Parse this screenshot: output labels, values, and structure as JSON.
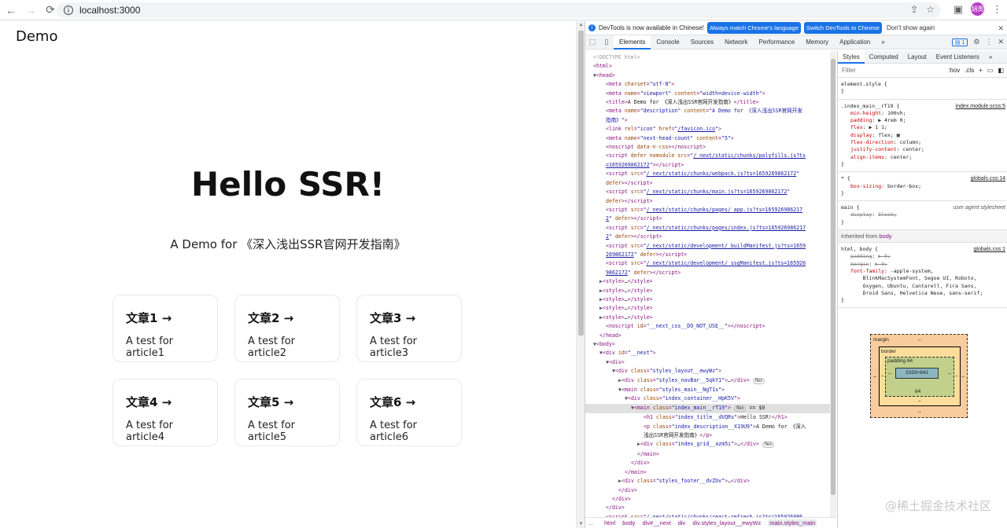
{
  "browser": {
    "url": "localhost:3000",
    "avatar": "胡周"
  },
  "page": {
    "brand": "Demo",
    "title": "Hello SSR!",
    "description": "A Demo for 《深入浅出SSR官网开发指南》",
    "cards": [
      {
        "title": "文章1 →",
        "text": "A test for article1"
      },
      {
        "title": "文章2 →",
        "text": "A test for article2"
      },
      {
        "title": "文章3 →",
        "text": "A test for article3"
      },
      {
        "title": "文章4 →",
        "text": "A test for article4"
      },
      {
        "title": "文章5 →",
        "text": "A test for article5"
      },
      {
        "title": "文章6 →",
        "text": "A test for article6"
      }
    ]
  },
  "devtools": {
    "infobar": {
      "message": "DevTools is now available in Chinese!",
      "match_btn": "Always match Chrome's language",
      "switch_btn": "Switch DevTools to Chinese",
      "dismiss": "Don't show again"
    },
    "tabs": [
      "Elements",
      "Console",
      "Sources",
      "Network",
      "Performance",
      "Memory",
      "Application"
    ],
    "issues_badge": "1",
    "styles_tabs": [
      "Styles",
      "Computed",
      "Layout",
      "Event Listeners"
    ],
    "filter_placeholder": "Filter",
    "hov": ":hov",
    "cls": ".cls",
    "breadcrumbs": [
      "html",
      "body",
      "div#__next",
      "div",
      "div.styles_layout__ewyWz",
      "main.styles_main"
    ],
    "inherited_label": "Inherited from",
    "inherited_from": "body",
    "box_model": {
      "margin": "margin",
      "border": "border",
      "padding": "padding 64",
      "content": "1033×841",
      "padding_bottom": "64",
      "dash": "–"
    },
    "rules": [
      {
        "selector": "element.style {",
        "source": "",
        "props": [],
        "close": "}"
      },
      {
        "selector": ".index_main__rT19 {",
        "source": "index.module.scss:5",
        "props": [
          {
            "n": "min-height",
            "v": "100vh;"
          },
          {
            "n": "padding",
            "v": "▶ 4rem 0;"
          },
          {
            "n": "flex",
            "v": "▶ 1 1;"
          },
          {
            "n": "display",
            "v": "flex; ▦"
          },
          {
            "n": "flex-direction",
            "v": "column;"
          },
          {
            "n": "justify-content",
            "v": "center;"
          },
          {
            "n": "align-items",
            "v": "center;"
          }
        ],
        "close": "}"
      },
      {
        "selector": "* {",
        "source": "globals.css:14",
        "props": [
          {
            "n": "box-sizing",
            "v": "border-box;"
          }
        ],
        "close": "}"
      },
      {
        "selector": "main {",
        "source": "user agent stylesheet",
        "ua": true,
        "props": [
          {
            "n": "display",
            "v": "block;",
            "struck": true
          }
        ],
        "close": "}"
      }
    ],
    "body_rule": {
      "selector": "html, body {",
      "source": "globals.css:1",
      "props": [
        {
          "n": "padding",
          "v": "▶ 0;",
          "struck": true
        },
        {
          "n": "margin",
          "v": "▶ 0;",
          "struck": true
        },
        {
          "n": "font-family",
          "v": "-apple-system,"
        },
        {
          "n": "",
          "v": "    BlinkMacSystemFont, Segoe UI, Roboto,"
        },
        {
          "n": "",
          "v": "    Oxygen, Ubuntu, Cantarell, Fira Sans,"
        },
        {
          "n": "",
          "v": "    Droid Sans, Helvetica Neue, sans-serif;"
        }
      ],
      "close": "}"
    },
    "dom_lines": [
      {
        "i": 0,
        "html": "<span class='cmt'>&lt;!DOCTYPE html&gt;</span>"
      },
      {
        "i": 0,
        "html": "<span class='tag'>&lt;html&gt;</span>"
      },
      {
        "i": 0,
        "html": "<span class='tri'>▼</span><span class='tag'>&lt;head&gt;</span>"
      },
      {
        "i": 2,
        "html": "<span class='tag'>&lt;meta </span><span class='attr'>charset</span>=<span class='val'>\"utf-8\"</span><span class='tag'>&gt;</span>"
      },
      {
        "i": 2,
        "html": "<span class='tag'>&lt;meta </span><span class='attr'>name</span>=<span class='val'>\"viewport\"</span> <span class='attr'>content</span>=<span class='val'>\"width=device-width\"</span><span class='tag'>&gt;</span>"
      },
      {
        "i": 2,
        "html": "<span class='tag'>&lt;title&gt;</span><span class='txt'>A Demo for 《深入浅出SSR官网开发指南》</span><span class='tag'>&lt;/title&gt;</span>"
      },
      {
        "i": 2,
        "html": "<span class='tag'>&lt;meta </span><span class='attr'>name</span>=<span class='val'>\"description\"</span> <span class='attr'>content</span>=<span class='val'>\"A Demo for 《深入浅出SSR官网开发</span>"
      },
      {
        "i": 2,
        "html": "<span class='val'>指南》\"</span><span class='tag'>&gt;</span>"
      },
      {
        "i": 2,
        "html": "<span class='tag'>&lt;link </span><span class='attr'>rel</span>=<span class='val'>\"icon\"</span> <span class='attr'>href</span>=<span class='val'>\"<span class='link'>/favicon.ico</span>\"</span><span class='tag'>&gt;</span>"
      },
      {
        "i": 2,
        "html": "<span class='tag'>&lt;meta </span><span class='attr'>name</span>=<span class='val'>\"next-head-count\"</span> <span class='attr'>content</span>=<span class='val'>\"5\"</span><span class='tag'>&gt;</span>"
      },
      {
        "i": 2,
        "html": "<span class='tag'>&lt;noscript </span><span class='attr'>data-n-css</span><span class='tag'>&gt;&lt;/noscript&gt;</span>"
      },
      {
        "i": 2,
        "html": "<span class='tag'>&lt;script </span><span class='attr'>defer nomodule src</span>=<span class='val'>\"<span class='link'>/_next/static/chunks/polyfills.js?ts</span></span>"
      },
      {
        "i": 2,
        "html": "<span class='link val'>=1659269862172</span><span class='val'>\"</span><span class='tag'>&gt;&lt;/script&gt;</span>"
      },
      {
        "i": 2,
        "html": "<span class='tag'>&lt;script </span><span class='attr'>src</span>=<span class='val'>\"<span class='link'>/_next/static/chunks/webpack.js?ts=1659269862172</span>\"</span>"
      },
      {
        "i": 2,
        "html": "<span class='attr'>defer</span><span class='tag'>&gt;&lt;/script&gt;</span>"
      },
      {
        "i": 2,
        "html": "<span class='tag'>&lt;script </span><span class='attr'>src</span>=<span class='val'>\"<span class='link'>/_next/static/chunks/main.js?ts=1659269862172</span>\"</span>"
      },
      {
        "i": 2,
        "html": "<span class='attr'>defer</span><span class='tag'>&gt;&lt;/script&gt;</span>"
      },
      {
        "i": 2,
        "html": "<span class='tag'>&lt;script </span><span class='attr'>src</span>=<span class='val'>\"<span class='link'>/_next/static/chunks/pages/_app.js?ts=165926986217</span></span>"
      },
      {
        "i": 2,
        "html": "<span class='link val'>2</span><span class='val'>\"</span> <span class='attr'>defer</span><span class='tag'>&gt;&lt;/script&gt;</span>"
      },
      {
        "i": 2,
        "html": "<span class='tag'>&lt;script </span><span class='attr'>src</span>=<span class='val'>\"<span class='link'>/_next/static/chunks/pages/index.js?ts=165926986217</span></span>"
      },
      {
        "i": 2,
        "html": "<span class='link val'>2</span><span class='val'>\"</span> <span class='attr'>defer</span><span class='tag'>&gt;&lt;/script&gt;</span>"
      },
      {
        "i": 2,
        "html": "<span class='tag'>&lt;script </span><span class='attr'>src</span>=<span class='val'>\"<span class='link'>/_next/static/development/_buildManifest.js?ts=1659</span></span>"
      },
      {
        "i": 2,
        "html": "<span class='link val'>269862172</span><span class='val'>\"</span> <span class='attr'>defer</span><span class='tag'>&gt;&lt;/script&gt;</span>"
      },
      {
        "i": 2,
        "html": "<span class='tag'>&lt;script </span><span class='attr'>src</span>=<span class='val'>\"<span class='link'>/_next/static/development/_ssgManifest.js?ts=165926</span></span>"
      },
      {
        "i": 2,
        "html": "<span class='link val'>9862172</span><span class='val'>\"</span> <span class='attr'>defer</span><span class='tag'>&gt;&lt;/script&gt;</span>"
      },
      {
        "i": 1,
        "html": "<span class='tri'>▶</span><span class='tag'>&lt;style&gt;</span><span class='txt'>…</span><span class='tag'>&lt;/style&gt;</span>"
      },
      {
        "i": 1,
        "html": "<span class='tri'>▶</span><span class='tag'>&lt;style&gt;</span><span class='txt'>…</span><span class='tag'>&lt;/style&gt;</span>"
      },
      {
        "i": 1,
        "html": "<span class='tri'>▶</span><span class='tag'>&lt;style&gt;</span><span class='txt'>…</span><span class='tag'>&lt;/style&gt;</span>"
      },
      {
        "i": 1,
        "html": "<span class='tri'>▶</span><span class='tag'>&lt;style&gt;</span><span class='txt'>…</span><span class='tag'>&lt;/style&gt;</span>"
      },
      {
        "i": 1,
        "html": "<span class='tri'>▶</span><span class='tag'>&lt;style&gt;</span><span class='txt'>…</span><span class='tag'>&lt;/style&gt;</span>"
      },
      {
        "i": 2,
        "html": "<span class='tag'>&lt;noscript </span><span class='attr'>id</span>=<span class='val'>\"__next_css__DO_NOT_USE__\"</span><span class='tag'>&gt;&lt;/noscript&gt;</span>"
      },
      {
        "i": 1,
        "html": "<span class='tag'>&lt;/head&gt;</span>"
      },
      {
        "i": 0,
        "html": "<span class='tri'>▼</span><span class='tag'>&lt;body&gt;</span>"
      },
      {
        "i": 1,
        "html": "<span class='tri'>▼</span><span class='tag'>&lt;div </span><span class='attr'>id</span>=<span class='val'>\"__next\"</span><span class='tag'>&gt;</span>"
      },
      {
        "i": 2,
        "html": "<span class='tri'>▼</span><span class='tag'>&lt;div&gt;</span>"
      },
      {
        "i": 3,
        "html": "<span class='tri'>▼</span><span class='tag'>&lt;div </span><span class='attr'>class</span>=<span class='val'>\"styles_layout__ewyWz\"</span><span class='tag'>&gt;</span>"
      },
      {
        "i": 4,
        "html": "<span class='tri'>▶</span><span class='tag'>&lt;div </span><span class='attr'>class</span>=<span class='val'>\"styles_navBar__5qkY1\"</span><span class='tag'>&gt;</span><span class='txt'>…</span><span class='tag'>&lt;/div&gt;</span> <span class='flexb'>flex</span>"
      },
      {
        "i": 4,
        "html": "<span class='tri'>▼</span><span class='tag'>&lt;main </span><span class='attr'>class</span>=<span class='val'>\"styles_main__NgT1s\"</span><span class='tag'>&gt;</span>"
      },
      {
        "i": 5,
        "html": "<span class='tri'>▼</span><span class='tag'>&lt;div </span><span class='attr'>class</span>=<span class='val'>\"index_container__HpK5V\"</span><span class='tag'>&gt;</span>"
      },
      {
        "i": 6,
        "sel": true,
        "html": "<span class='tri'>▼</span><span class='tag'>&lt;main </span><span class='attr'>class</span>=<span class='val'>\"index_main__rT19\"</span><span class='tag'>&gt;</span> <span class='flexb'>flex</span> <span class='txt'>== $0</span>"
      },
      {
        "i": 8,
        "html": "<span class='tag'>&lt;h1 </span><span class='attr'>class</span>=<span class='val'>\"index_title__dVQRs\"</span><span class='tag'>&gt;</span><span class='txt'>Hello SSR!</span><span class='tag'>&lt;/h1&gt;</span>"
      },
      {
        "i": 8,
        "html": "<span class='tag'>&lt;p </span><span class='attr'>class</span>=<span class='val'>\"index_description__X19U9\"</span><span class='tag'>&gt;</span><span class='txt'>A Demo for 《深入</span>"
      },
      {
        "i": 8,
        "html": "<span class='txt'>浅出SSR官网开发指南》</span><span class='tag'>&lt;/p&gt;</span>"
      },
      {
        "i": 7,
        "html": "<span class='tri'>▶</span><span class='tag'>&lt;div </span><span class='attr'>class</span>=<span class='val'>\"index_grid__azm5i\"</span><span class='tag'>&gt;</span><span class='txt'>…</span><span class='tag'>&lt;/div&gt;</span> <span class='flexb'>flex</span>"
      },
      {
        "i": 7,
        "html": "<span class='tag'>&lt;/main&gt;</span>"
      },
      {
        "i": 6,
        "html": "<span class='tag'>&lt;/div&gt;</span>"
      },
      {
        "i": 5,
        "html": "<span class='tag'>&lt;/main&gt;</span>"
      },
      {
        "i": 4,
        "html": "<span class='tri'>▶</span><span class='tag'>&lt;div </span><span class='attr'>class</span>=<span class='val'>\"styles_footer__dvZbv\"</span><span class='tag'>&gt;</span><span class='txt'>…</span><span class='tag'>&lt;/div&gt;</span>"
      },
      {
        "i": 4,
        "html": "<span class='tag'>&lt;/div&gt;</span>"
      },
      {
        "i": 3,
        "html": "<span class='tag'>&lt;/div&gt;</span>"
      },
      {
        "i": 2,
        "html": "<span class='tag'>&lt;/div&gt;</span>"
      },
      {
        "i": 2,
        "html": "<span class='tag'>&lt;script </span><span class='attr'>src</span>=<span class='val'>\"<span class='link'>/_next/static/chunks/react-refresh.js?ts=165926986</span></span>"
      }
    ]
  },
  "watermark": "@稀土掘金技术社区"
}
